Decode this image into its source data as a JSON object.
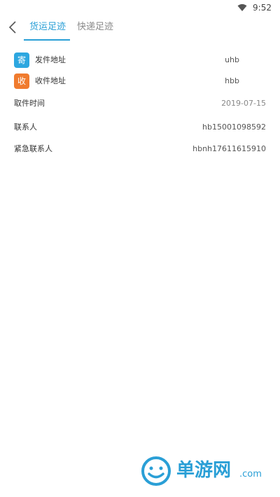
{
  "status_bar": {
    "time": "9:52"
  },
  "tabs": [
    {
      "label": "货运足迹",
      "active": true
    },
    {
      "label": "快递足迹",
      "active": false
    }
  ],
  "rows": [
    {
      "icon_text": "寄",
      "icon": "send-badge-icon",
      "label": "发件地址",
      "value": "uhb"
    },
    {
      "icon_text": "收",
      "icon": "receive-badge-icon",
      "label": "收件地址",
      "value": "hbb"
    },
    {
      "label": "取件时间",
      "value": "2019-07-15"
    },
    {
      "label": "联系人",
      "value": "hb15001098592"
    },
    {
      "label": "紧急联系人",
      "value": "hbnh17611615910"
    }
  ],
  "watermark": {
    "brand": "单游网",
    "domain": ".com"
  },
  "colors": {
    "accent": "#2a9fd6",
    "send_badge": "#2da7e0",
    "receive_badge": "#f07b2e"
  }
}
